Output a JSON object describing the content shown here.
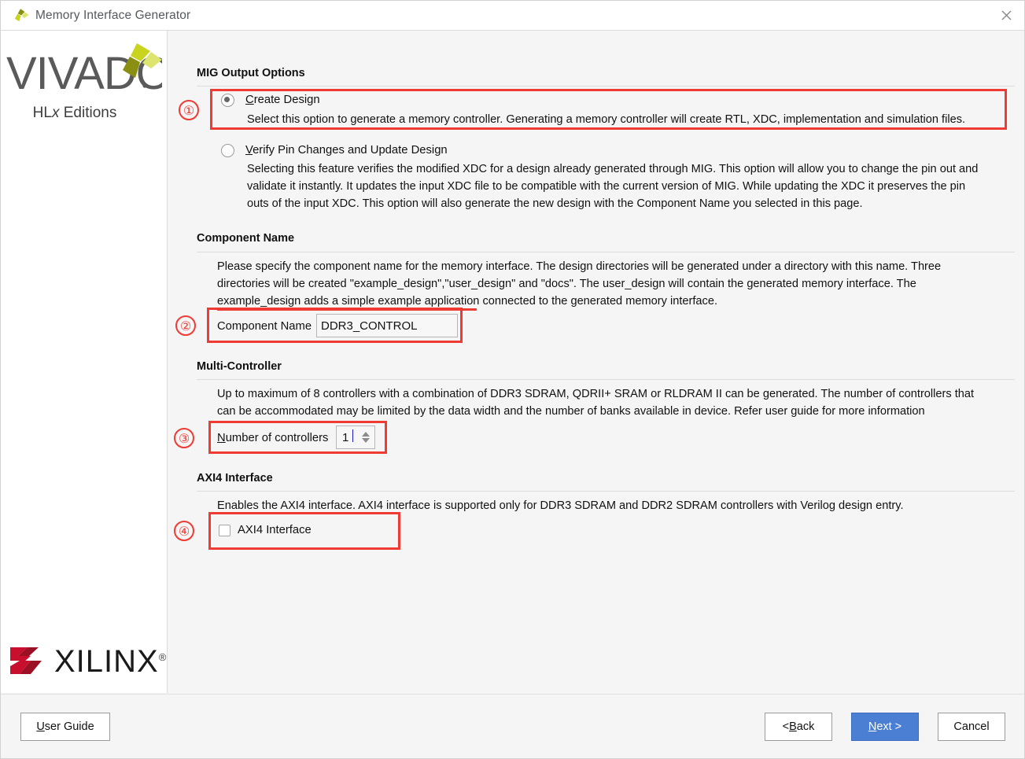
{
  "window": {
    "title": "Memory Interface Generator",
    "close_icon": "close-icon"
  },
  "branding": {
    "vivado_name": "VIVADO",
    "vivado_edition_prefix": "HL",
    "vivado_edition_italic": "x",
    "vivado_edition_suffix": " Editions",
    "xilinx_name": "XILINX",
    "xilinx_registered": "®",
    "vivado_logo_colors": [
      "#c8d41e",
      "#8a8f12",
      "#dde56f"
    ],
    "xilinx_logo_color": "#c8102e",
    "xilinx_logo_color_dark": "#9b1024"
  },
  "sections": {
    "mig_output": {
      "heading": "MIG Output Options",
      "options": [
        {
          "label_mnemonic": "C",
          "label_rest": "reate Design",
          "selected": true,
          "description": "Select this option to generate a memory controller. Generating a memory controller will create RTL, XDC, implementation and simulation files."
        },
        {
          "label_mnemonic": "V",
          "label_rest": "erify Pin Changes and Update Design",
          "selected": false,
          "description_lines": [
            "Selecting this feature verifies the modified XDC for a design already generated through MIG. This option will allow you to change the pin out and",
            "validate it instantly. It updates the input XDC file to be compatible with the current version of MIG. While updating the XDC it preserves the pin",
            "outs of the input XDC. This option will also generate the new design with the Component Name you selected in this page."
          ]
        }
      ]
    },
    "component_name": {
      "heading": "Component Name",
      "description_lines": [
        "Please specify the component name for the memory interface. The design directories will be generated under a directory with this name. Three",
        "directories will be created \"example_design\",\"user_design\" and \"docs\". The user_design will contain the generated memory interface. The",
        "example_design adds a simple example application connected to the generated memory interface."
      ],
      "field_label": "Component Name",
      "field_value": "DDR3_CONTROL"
    },
    "multi_controller": {
      "heading": "Multi-Controller",
      "description_lines": [
        "Up to maximum of 8 controllers with a combination of DDR3 SDRAM, QDRII+ SRAM or RLDRAM II can be generated. The number of controllers that",
        "can be accommodated may be limited by the data width and the number of banks available in device. Refer user guide for more information"
      ],
      "field_label_mnemonic": "N",
      "field_label_rest": "umber of controllers",
      "field_value": "1"
    },
    "axi4": {
      "heading": "AXI4 Interface",
      "description": "Enables the AXI4 interface. AXI4 interface is supported only for DDR3 SDRAM and DDR2 SDRAM controllers with Verilog design entry.",
      "checkbox_label": "AXI4 Interface",
      "checked": false
    }
  },
  "annotations": {
    "marker_1": "①",
    "marker_2": "②",
    "marker_3": "③",
    "marker_4": "④",
    "color": "#ee3b33"
  },
  "footer": {
    "user_guide_mnemonic": "U",
    "user_guide_rest": "ser Guide",
    "back_prefix": "< ",
    "back_mnemonic": "B",
    "back_rest": "ack",
    "next_mnemonic": "N",
    "next_rest": "ext >",
    "cancel_label": "Cancel",
    "primary_color": "#4a7fd4"
  }
}
